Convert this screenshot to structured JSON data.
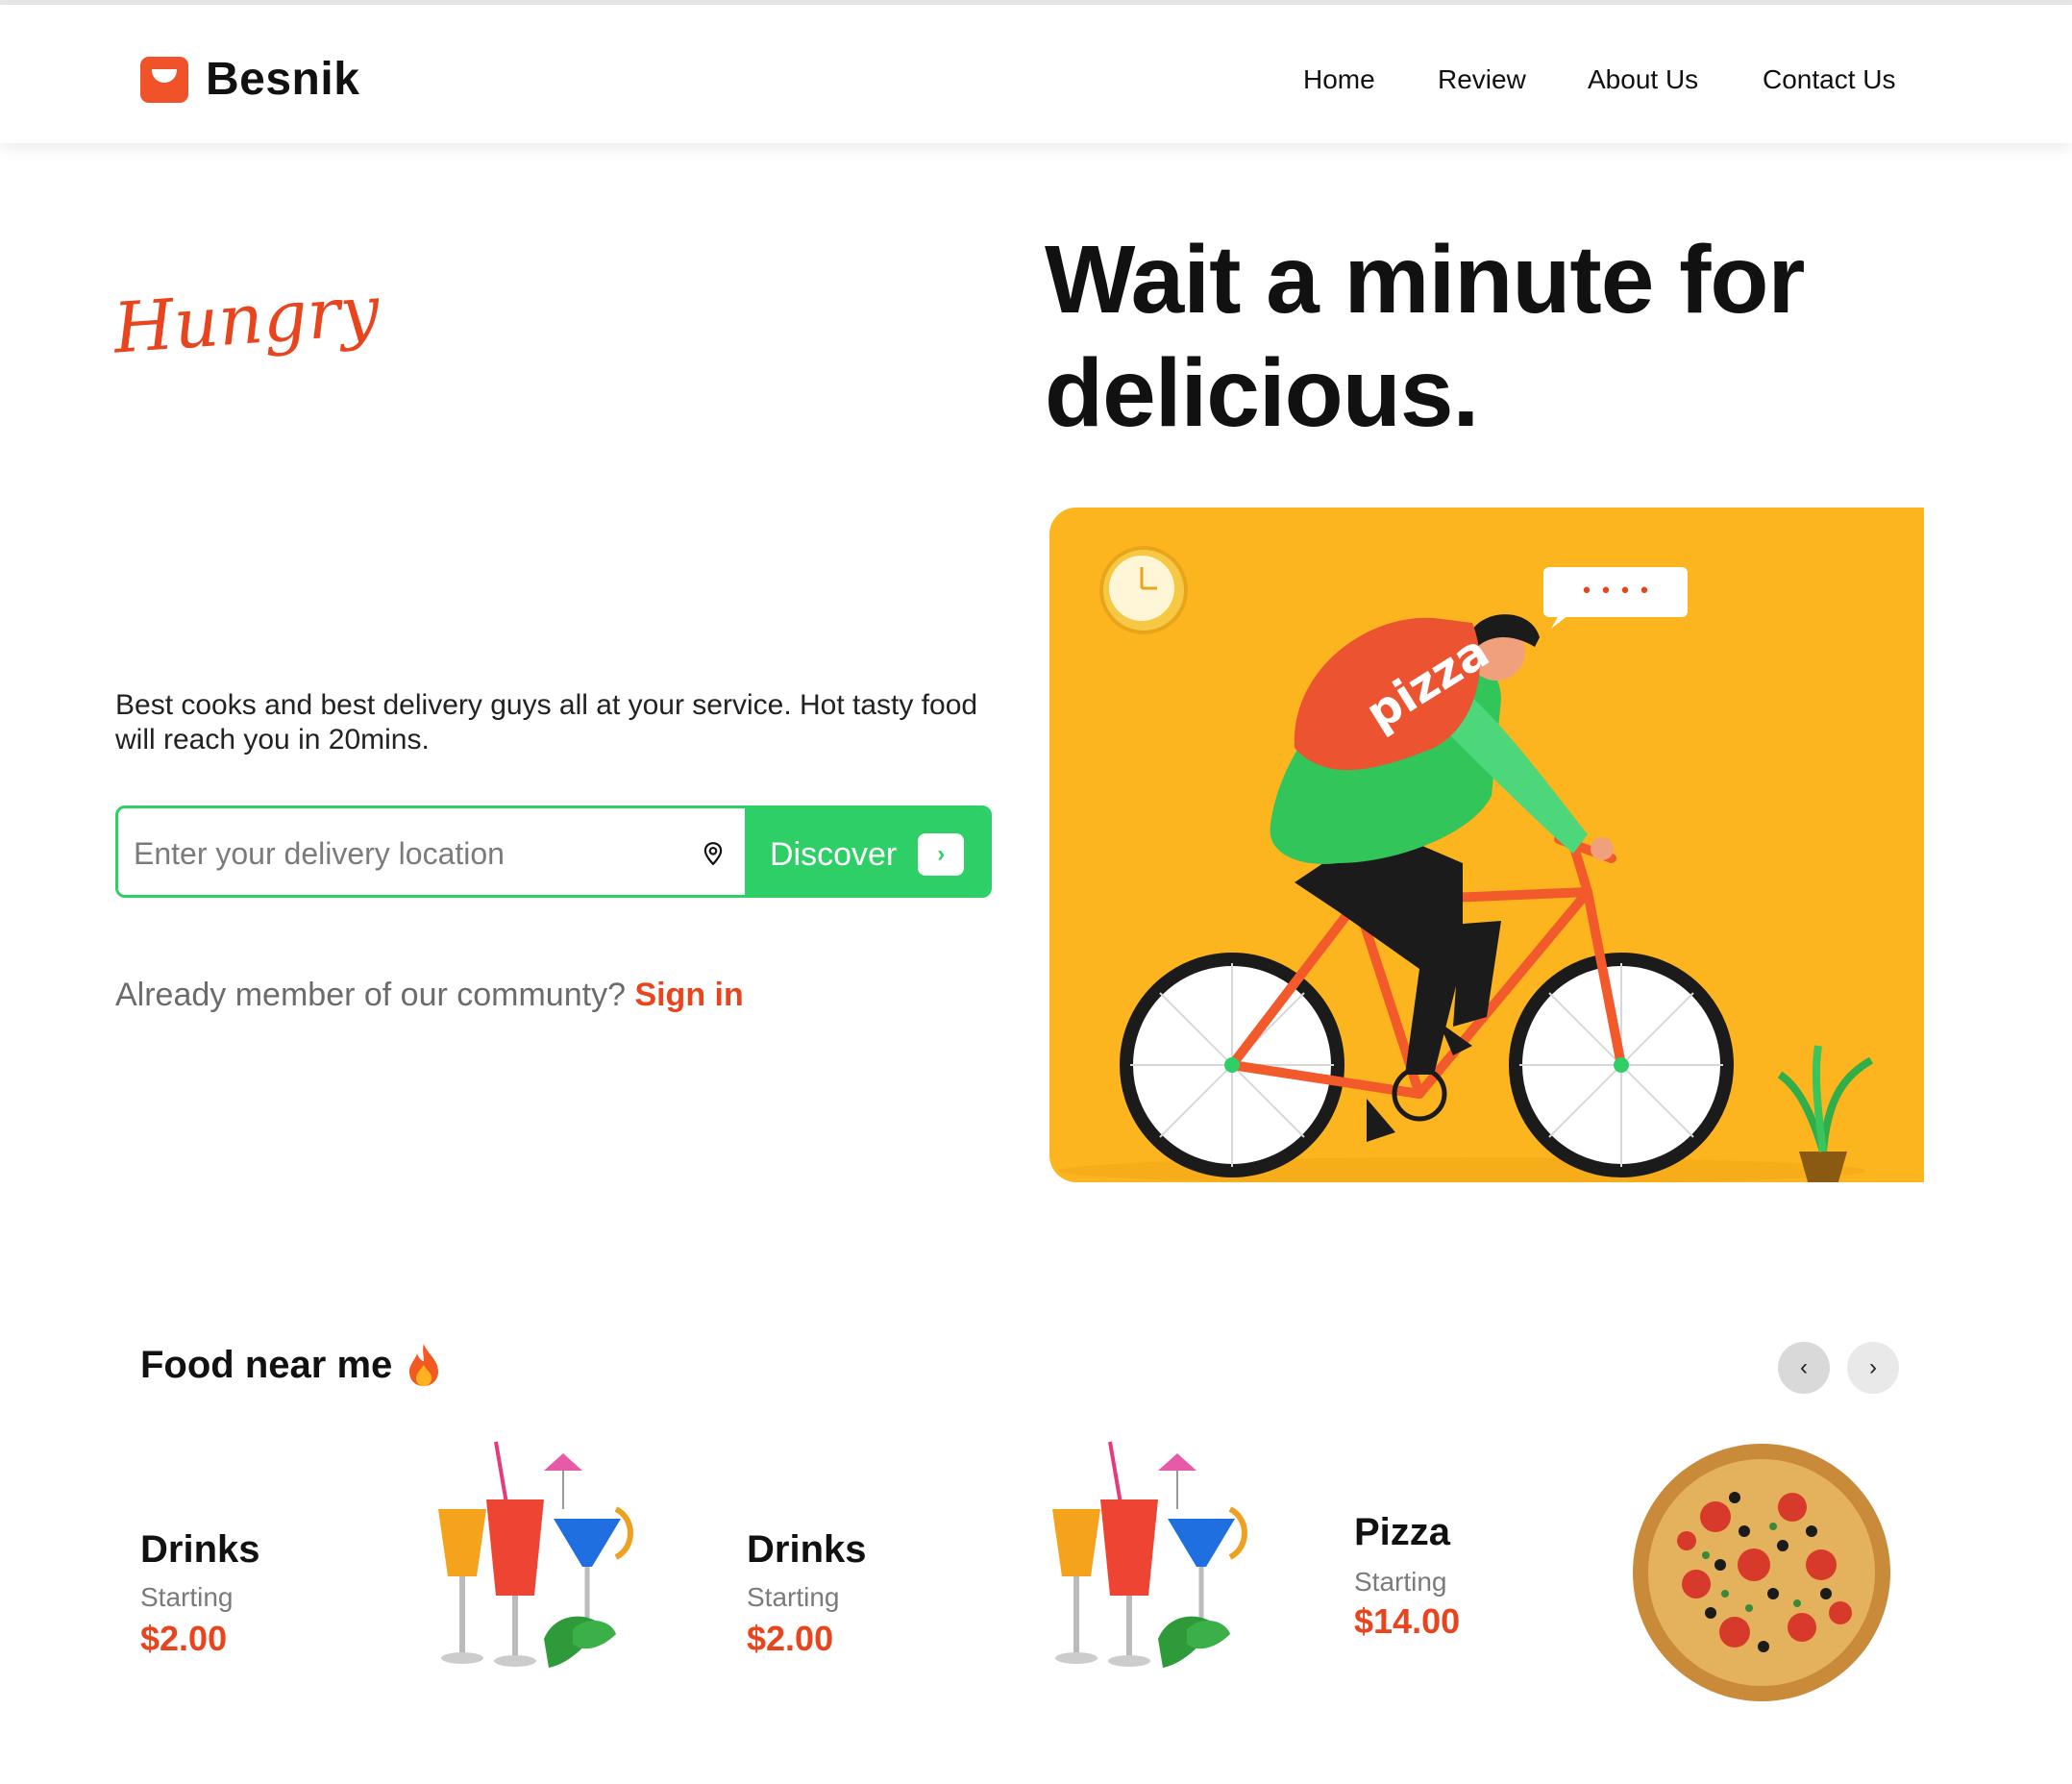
{
  "brand": {
    "name": "Besnik",
    "logo_icon": "bag-smile-icon",
    "color": "#f0532a"
  },
  "nav": [
    {
      "label": "Home"
    },
    {
      "label": "Review"
    },
    {
      "label": "About Us"
    },
    {
      "label": "Contact Us"
    }
  ],
  "hero": {
    "script_word": "Hungry",
    "headline": "Wait a minute for delicious.",
    "tagline": "Best cooks and best delivery guys all at your service. Hot tasty food will reach you in 20mins.",
    "search": {
      "placeholder": "Enter your delivery location",
      "icon": "location-pin-icon"
    },
    "discover_label": "Discover",
    "member_text": "Already member of our communty?",
    "signin_label": "Sign in",
    "illustration": {
      "bag_text": "pizza",
      "bubble": "• • • •",
      "background": "#fdb51f"
    }
  },
  "food_near": {
    "title": "Food near me",
    "icon": "fire-icon",
    "items": [
      {
        "name": "Drinks",
        "starting": "Starting",
        "price": "$2.00"
      },
      {
        "name": "Drinks",
        "starting": "Starting",
        "price": "$2.00"
      },
      {
        "name": "Pizza",
        "starting": "Starting",
        "price": "$14.00"
      }
    ]
  },
  "colors": {
    "accent": "#e8451e",
    "green": "#2fcf67"
  }
}
